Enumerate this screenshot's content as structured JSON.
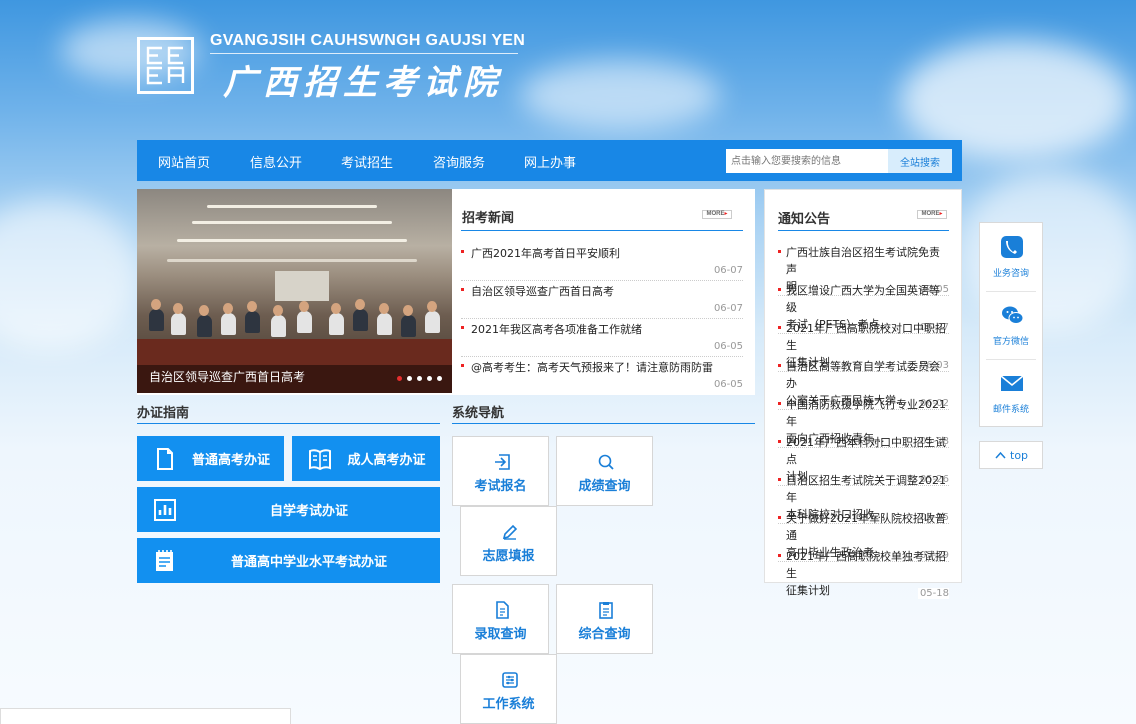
{
  "header": {
    "site_name_en": "GVANGJSIH CAUHSWNGH GAUJSI YEN",
    "site_name_cn": "广西招生考试院",
    "logo_text": "GEEA"
  },
  "nav": {
    "items": [
      {
        "label": "网站首页"
      },
      {
        "label": "信息公开"
      },
      {
        "label": "考试招生"
      },
      {
        "label": "咨询服务"
      },
      {
        "label": "网上办事"
      }
    ],
    "search_placeholder": "点击输入您要搜索的信息",
    "search_button": "全站搜索"
  },
  "slideshow": {
    "caption": "自治区领导巡查广西首日高考",
    "slide_count": 5,
    "active_index": 0
  },
  "news": {
    "title": "招考新闻",
    "more_label": "MORE",
    "items": [
      {
        "text": "广西2021年高考首日平安顺利",
        "date": "06-07"
      },
      {
        "text": "自治区领导巡查广西首日高考",
        "date": "06-07"
      },
      {
        "text": "2021年我区高考各项准备工作就绪",
        "date": "06-05"
      },
      {
        "text": "@高考考生：高考天气预报来了！请注意防雨防雷",
        "date": "06-05"
      }
    ]
  },
  "notices": {
    "title": "通知公告",
    "more_label": "MORE",
    "items": [
      {
        "line1": "广西壮族自治区招生考试院免责声",
        "line2": "明",
        "date": "09-05"
      },
      {
        "line1": "我区增设广西大学为全国英语等级",
        "line2": "考试（PETS）考点...",
        "date": "06-07"
      },
      {
        "line1": "2021年广西高职院校对口中职招生",
        "line2": "征集计划",
        "date": "06-03"
      },
      {
        "line1": "自治区高等教育自学考试委员会办",
        "line2": "公室关于广西民族大学...",
        "date": "06-02"
      },
      {
        "line1": "中国消防救援学院飞行专业2021年",
        "line2": "面向广西招收青年...",
        "date": "05-28"
      },
      {
        "line1": "2021年广西本科对口中职招生试点",
        "line2": "计划",
        "date": "05-26"
      },
      {
        "line1": "自治区招生考试院关于调整2021年",
        "line2": "本科院校对口招收...",
        "date": "05-25"
      },
      {
        "line1": "关于做好2021年军队院校招收普通",
        "line2": "高中毕业生政治考...",
        "date": "05-19"
      },
      {
        "line1": "2021年广西高职院校单独考试招生",
        "line2": "征集计划",
        "date": "05-18"
      }
    ]
  },
  "guide": {
    "title": "办证指南",
    "buttons": [
      {
        "label": "普通高考办证",
        "icon": "document-icon"
      },
      {
        "label": "成人高考办证",
        "icon": "book-icon"
      },
      {
        "label": "自学考试办证",
        "icon": "chart-icon"
      },
      {
        "label": "普通高中学业水平考试办证",
        "icon": "clipboard-icon"
      }
    ]
  },
  "system_nav": {
    "title": "系统导航",
    "items": [
      {
        "label": "考试报名",
        "icon": "login-icon"
      },
      {
        "label": "成绩查询",
        "icon": "search-icon"
      },
      {
        "label": "志愿填报",
        "icon": "pencil-icon"
      },
      {
        "label": "录取查询",
        "icon": "file-icon"
      },
      {
        "label": "综合查询",
        "icon": "report-icon"
      },
      {
        "label": "工作系统",
        "icon": "settings-icon"
      }
    ]
  },
  "float_bar": {
    "items": [
      {
        "label": "业务咨询",
        "icon": "phone-icon"
      },
      {
        "label": "官方微信",
        "icon": "wechat-icon"
      },
      {
        "label": "邮件系统",
        "icon": "mail-icon"
      }
    ],
    "top_label": "top"
  },
  "colors": {
    "primary": "#1887e6",
    "button": "#1290f0",
    "accent_red": "#e22222"
  }
}
